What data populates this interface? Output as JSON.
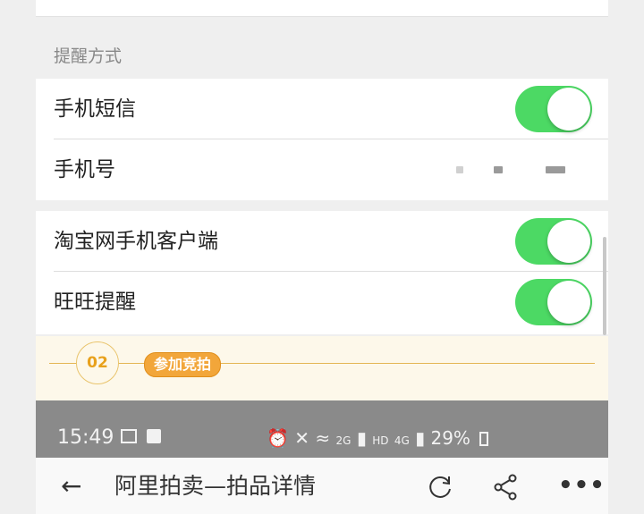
{
  "settings": {
    "section_title": "提醒方式",
    "items": [
      {
        "label": "手机短信",
        "toggle_on": true
      },
      {
        "label": "手机号",
        "value_masked": true
      },
      {
        "label": "淘宝网手机客户端",
        "toggle_on": true
      },
      {
        "label": "旺旺提醒",
        "toggle_on": true
      }
    ]
  },
  "step": {
    "number": "02",
    "label": "参加竞拍"
  },
  "status_bar": {
    "time": "15:49",
    "battery": "29%",
    "signal_text_1": "HD",
    "signal_text_2": "4G",
    "signal_text_3": "2G"
  },
  "nav": {
    "back_icon": "←",
    "title": "阿里拍卖—拍品详情",
    "more_icon": "•••"
  },
  "colors": {
    "toggle_on": "#4cd964",
    "accent": "#f2a63a",
    "status_bar_bg": "#8a8a8a"
  }
}
